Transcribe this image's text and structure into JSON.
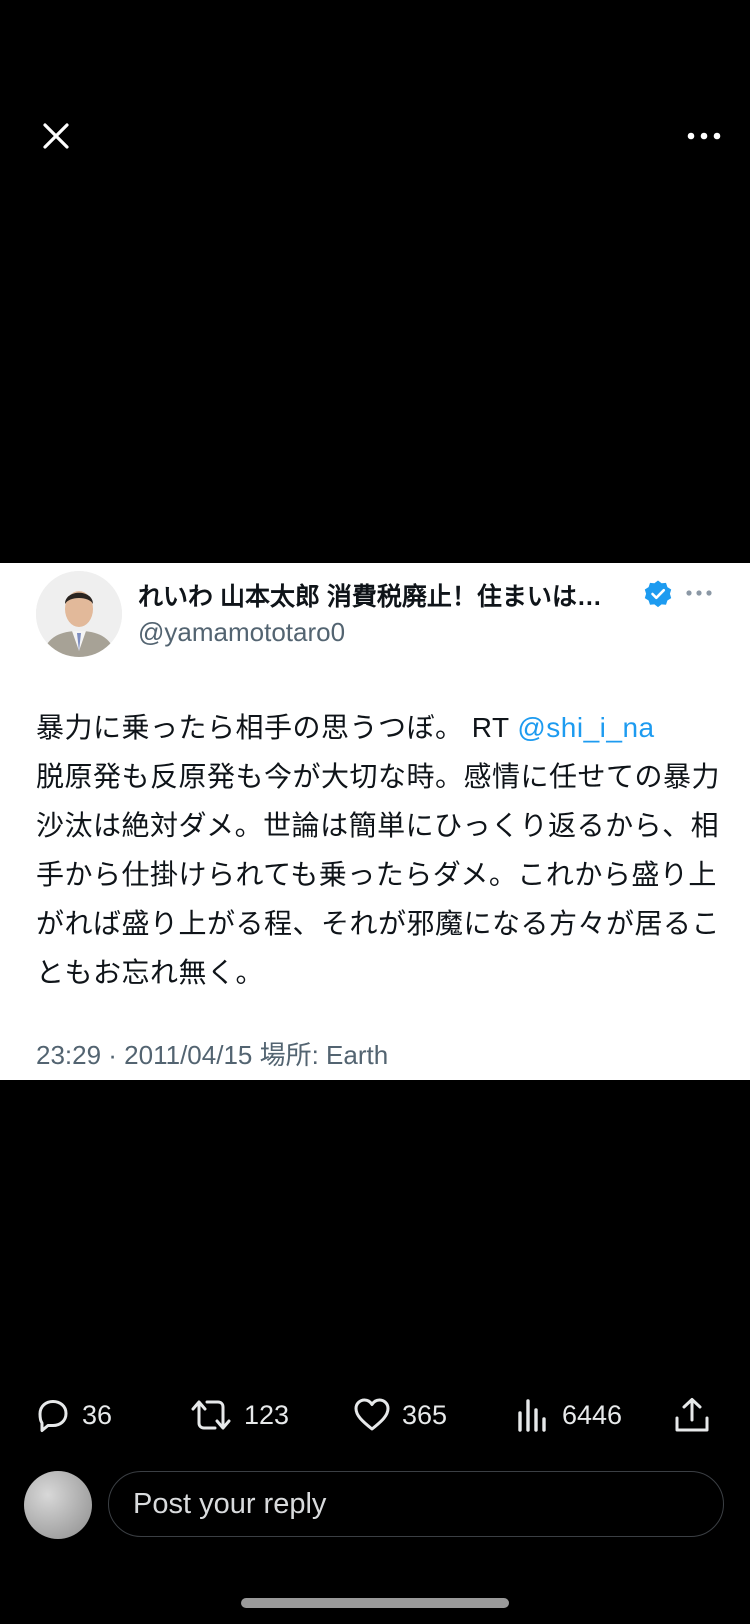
{
  "topbar": {
    "close_icon": "close-icon",
    "more_icon": "more-horizontal-icon"
  },
  "tweet": {
    "author_name": "れいわ 山本太郎 消費税廃止！住まいは…",
    "handle": "@yamamototaro0",
    "text_before_mention": "暴力に乗ったら相手の思うつぼ。 RT ",
    "mention": "@shi_i_na",
    "text_after_mention": "脱原発も反原発も今が大切な時。感情に任せての暴力沙汰は絶対ダメ。世論は簡単にひっくり返るから、相手から仕掛けられても乗ったらダメ。これから盛り上がれば盛り上がる程、それが邪魔になる方々が居ることもお忘れ無く。",
    "meta": "23:29 · 2011/04/15 場所: Earth",
    "verified_color": "#1d9bf0",
    "mention_color": "#1d9bf0"
  },
  "actions": {
    "replies": "36",
    "retweets": "123",
    "likes": "365",
    "views": "6446"
  },
  "reply": {
    "placeholder": "Post your reply"
  }
}
